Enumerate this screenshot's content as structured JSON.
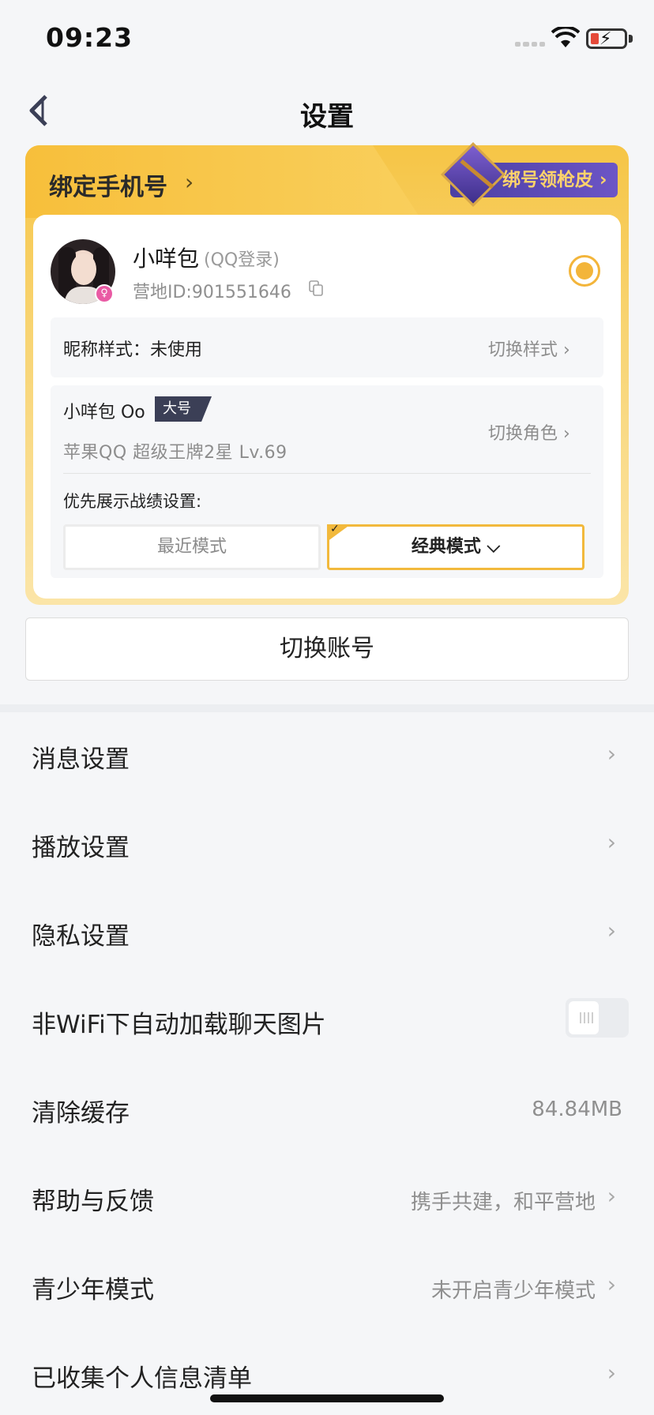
{
  "status_bar": {
    "time": "09:23"
  },
  "nav": {
    "title": "设置"
  },
  "account_card": {
    "bind_phone_label": "绑定手机号",
    "bind_phone_chevron": "›",
    "skin_promo_label": "绑号领枪皮 ›",
    "user": {
      "name": "小咩包",
      "login_type": "(QQ登录)",
      "camp_id": "营地ID:901551646"
    },
    "nickname_style": {
      "label": "昵称样式：未使用",
      "action": "切换样式 ›"
    },
    "role": {
      "name": "小咩包 Oo",
      "tag": "大号",
      "info": "苹果QQ  超级王牌2星  Lv.69",
      "action": "切换角色 ›"
    },
    "priority": {
      "label": "优先展示战绩设置:",
      "recent_mode": "最近模式",
      "classic_mode": "经典模式 ⌵",
      "selected": "经典模式"
    }
  },
  "switch_account_label": "切换账号",
  "settings_list": [
    {
      "label": "消息设置",
      "value": "",
      "chevron": "›"
    },
    {
      "label": "播放设置",
      "value": "",
      "chevron": "›"
    },
    {
      "label": "隐私设置",
      "value": "",
      "chevron": "›"
    },
    {
      "label": "非WiFi下自动加载聊天图片",
      "toggle": false
    },
    {
      "label": "清除缓存",
      "value": "84.84MB"
    },
    {
      "label": "帮助与反馈",
      "value": "携手共建，和平营地",
      "chevron": "›"
    },
    {
      "label": "青少年模式",
      "value": "未开启青少年模式",
      "chevron": "›"
    },
    {
      "label": "已收集个人信息清单",
      "value": "",
      "chevron": "›"
    }
  ],
  "colors": {
    "accent_yellow": "#f3b53a",
    "card_gradient_top": "#f6c546",
    "promo_purple": "#4b3fa3",
    "background": "#f5f6f8"
  }
}
